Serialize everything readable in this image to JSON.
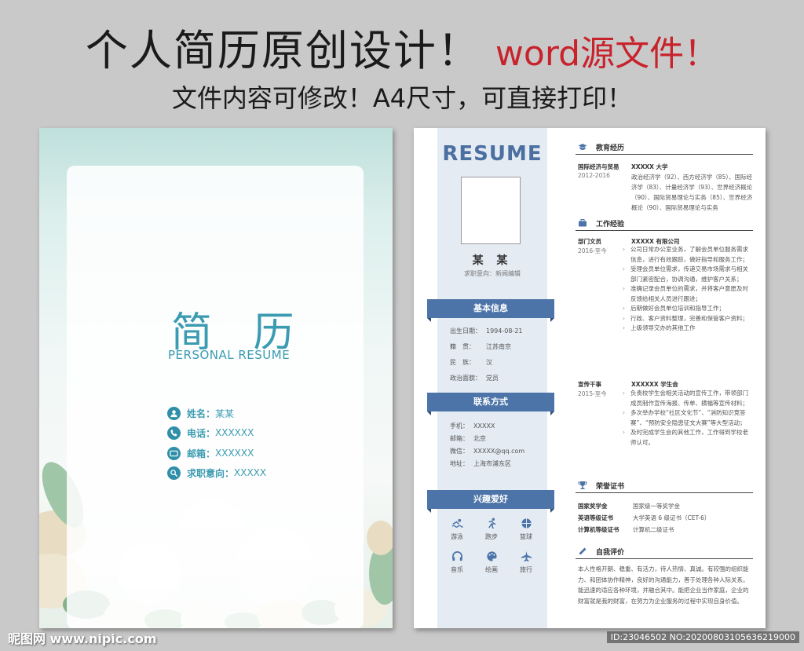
{
  "header": {
    "title": "个人简历原创设计！",
    "title_red": "word源文件！",
    "subtitle": "文件内容可修改！A4尺寸，可直接打印！"
  },
  "cover": {
    "title": "简 历",
    "subtitle": "PERSONAL RESUME",
    "fields": [
      {
        "icon": "person-icon",
        "label": "姓名：",
        "value": "某某"
      },
      {
        "icon": "phone-icon",
        "label": "电话：",
        "value": "XXXXXX"
      },
      {
        "icon": "mail-icon",
        "label": "邮箱：",
        "value": "XXXXXX"
      },
      {
        "icon": "search-icon",
        "label": "求职意向：",
        "value": "XXXXX"
      }
    ]
  },
  "resume": {
    "title": "RESUME",
    "name": "某 某",
    "intent": "求职意向：新闻编辑",
    "basic": {
      "heading": "基本信息",
      "rows": [
        {
          "k": "出生日期：",
          "v": "1994-08-21"
        },
        {
          "k": "籍　贯：",
          "v": "江苏南京"
        },
        {
          "k": "民　族：",
          "v": "汉"
        },
        {
          "k": "政治面貌：",
          "v": "党员"
        }
      ]
    },
    "contact": {
      "heading": "联系方式",
      "rows": [
        {
          "k": "手机：",
          "v": "XXXXX"
        },
        {
          "k": "邮箱：",
          "v": "北京"
        },
        {
          "k": "微信：",
          "v": "XXXXX@qq.com"
        },
        {
          "k": "地址：",
          "v": "上海市浦东区"
        }
      ]
    },
    "hobbies": {
      "heading": "兴趣爱好",
      "items": [
        {
          "icon": "swim-icon",
          "label": "游泳"
        },
        {
          "icon": "run-icon",
          "label": "跑步"
        },
        {
          "icon": "basketball-icon",
          "label": "篮球"
        },
        {
          "icon": "headphones-icon",
          "label": "音乐"
        },
        {
          "icon": "palette-icon",
          "label": "绘画"
        },
        {
          "icon": "plane-icon",
          "label": "旅行"
        }
      ]
    },
    "education": {
      "heading": "教育经历",
      "major": "国际经济与贸易",
      "dates": "2012-2016",
      "school": "XXXXX 大学",
      "courses": "政治经济学（92）、西方经济学（85）、国际经济学（83）、计量经济学（93）、世界经济概论（90）、国际贸易理论与实务（85）、世界经济概论（90）、国际贸易理论与实务"
    },
    "work": {
      "heading": "工作经验",
      "jobs": [
        {
          "role": "部门文员",
          "dates": "2016-至今",
          "company": "XXXXX 有限公司",
          "duties": [
            "公司日常办公室业务，了解会员单位服务需求信息，进行有效跟踪，做好指导和服务工作；",
            "受理会员单位需求，传递交易市场需求与相关部门紧密配合，协调沟通，维护客户关系；",
            "准确记录会员单位的需求，并将客户意愿及时反馈给相关人员进行跟进；",
            "后期做好会员单位培训和指导工作；",
            "行政、客户资料整理，完善和保管客户资料；",
            "上级领导交办的其他工作"
          ]
        },
        {
          "role": "宣传干事",
          "dates": "2015-至今",
          "company": "XXXXXX 学生会",
          "duties": [
            "负责校学生会相关活动的宣传工作，带领部门成员制作宣传海报、传单、横幅等宣传材料；",
            "多次举办学校“社区文化节”、“消防知识竞答赛”、“预防安全隐患征文大赛”等大型活动；",
            "及时完成学生会的其他工作，工作得到学校老师认可。"
          ]
        }
      ]
    },
    "honors": {
      "heading": "荣誉证书",
      "items": [
        {
          "k": "国家奖学金",
          "v": "国家级一等奖学金"
        },
        {
          "k": "英语等级证书",
          "v": "大学英语 6 级证书（CET-6）"
        },
        {
          "k": "计算机等级证书",
          "v": "计算机二级证书"
        }
      ]
    },
    "self": {
      "heading": "自我评价",
      "text": "本人性格开朗、稳重、有活力，待人热情、真诚。有较强的组织能力、和团体协作精神，良好的沟通能力，善于处理各种人际关系。能迅速的适应各种环境，并融合其中。能把企业当作家庭，企业的财富就是我的财富，在努力为企业服务的过程中实现自身价值。"
    }
  },
  "watermark": {
    "left": "昵图网 www.nipic.com",
    "right": "ID:23046502 NO:20200803105636219000"
  },
  "colors": {
    "accent": "#4c74a8",
    "teal": "#3a9bb1",
    "red": "#c8232c"
  }
}
